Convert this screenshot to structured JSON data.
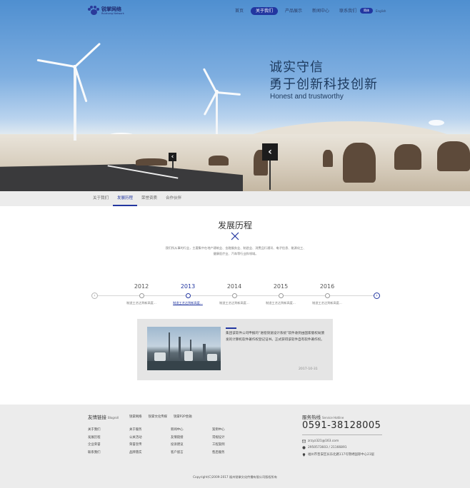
{
  "header": {
    "logo_cn": "锐掌网络",
    "logo_en": "Ruizhang Network",
    "nav": [
      {
        "label": "首页",
        "active": false
      },
      {
        "label": "关于我们",
        "active": true
      },
      {
        "label": "产品展示",
        "active": false
      },
      {
        "label": "新闻中心",
        "active": false
      },
      {
        "label": "联系我们",
        "active": false
      }
    ],
    "lang_active": "简体",
    "lang_other": "English"
  },
  "hero": {
    "title_line1": "诚实守信",
    "title_line2": "勇于创新科技创新",
    "subtitle": "Honest and trustworthy"
  },
  "subnav": {
    "items": [
      {
        "label": "关于我们",
        "active": false
      },
      {
        "label": "发展历程",
        "active": true
      },
      {
        "label": "荣誉资质",
        "active": false
      },
      {
        "label": "合作伙伴",
        "active": false
      }
    ]
  },
  "history": {
    "title": "发展历程",
    "description": "我们所从事的行业，主要集中在地产建筑业、金融服务业、制造业、消费品行通讯、电子信息、能源化工、健康医疗业、汽车等行业和领域。",
    "timeline": [
      {
        "year": "2012",
        "label": "制造工艺达到新高度...",
        "active": false
      },
      {
        "year": "2013",
        "label": "制造工艺达到新高度...",
        "active": true
      },
      {
        "year": "2014",
        "label": "制造工艺达到新高度...",
        "active": false
      },
      {
        "year": "2015",
        "label": "制造工艺达到新高度...",
        "active": false
      },
      {
        "year": "2016",
        "label": "制造工艺达到新高度...",
        "active": false
      }
    ],
    "prev_arrow": "‹",
    "next_arrow": "›",
    "event": {
      "text": "集团该软件公司申报的“进程快速设计系统”软件收到由国家版权局颁发的计算机软件著作权登记证书。正式获得该软件自有软件著作权。",
      "date": "2017-10-31"
    }
  },
  "footer": {
    "links_title": "友情链接",
    "links_title_en": "Blogroll",
    "links": [
      "锐掌网络",
      "锐掌文化传媒",
      "锐掌P2P金融"
    ],
    "columns": [
      [
        "关于我们",
        "发展历程",
        "企业荣誉",
        "联系我们"
      ],
      [
        "关于服务",
        "公关活动",
        "荣誉宣传",
        "品牌落实"
      ],
      [
        "新闻中心",
        "友情链接",
        "投诉建议",
        "客户留言"
      ],
      [
        "案例中心",
        "常规设计",
        "工程案例",
        "售后服务"
      ]
    ],
    "hotline_title": "服务热线",
    "hotline_title_en": "Service Hotline",
    "hotline": "0591-38128005",
    "email": "zrzyz321@163.com",
    "qq": "2950573603 / 21166891",
    "address": "福州市晋安区长乐北路117号锦绣国际中心23层",
    "copyright": "Copyright(C)2009-2017 福州锐掌文化传播有限公司版权所有"
  }
}
